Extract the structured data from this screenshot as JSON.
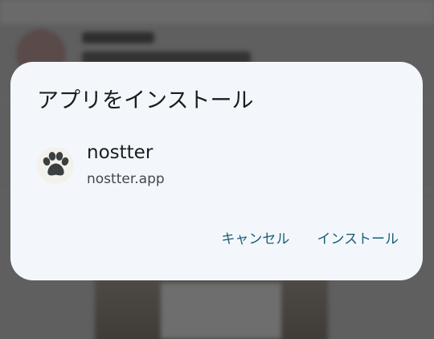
{
  "dialog": {
    "title": "アプリをインストール",
    "app": {
      "name": "nostter",
      "domain": "nostter.app",
      "icon": "paw-icon"
    },
    "actions": {
      "cancel_label": "キャンセル",
      "install_label": "インストール"
    }
  },
  "colors": {
    "dialog_background": "#f3f7fb",
    "title_text": "#1a1c1e",
    "secondary_text": "#42474e",
    "action_text": "#1b5e74",
    "scrim": "#5f5f5f",
    "icon_glyph": "#3a3f3f"
  }
}
